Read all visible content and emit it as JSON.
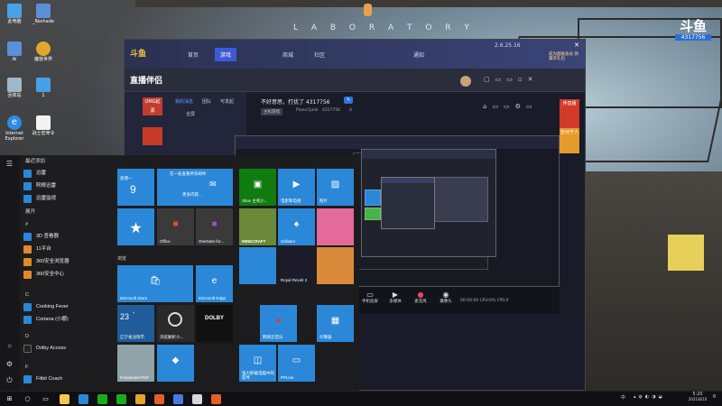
{
  "desktop": {
    "title": "L A B O R A T O R Y",
    "subtitle": "",
    "watermark_mark": "斗鱼",
    "watermark_room": "4317756",
    "icons": [
      {
        "label": "此电脑",
        "color": "#4aa0e6",
        "icon": "computer-icon"
      },
      {
        "label": "_Reshade",
        "color": "#5b8fd8",
        "icon": "folder-icon"
      },
      {
        "label": "Ai",
        "color": "#5b8fd8",
        "icon": "app-icon"
      },
      {
        "label": "魔兽世界",
        "color": "#e0a72a",
        "icon": "game-icon"
      },
      {
        "label": "回收站",
        "color": "#9fb7c9",
        "icon": "recycle-bin-icon"
      },
      {
        "label": "1",
        "color": "#4aa0e6",
        "icon": "app-icon"
      },
      {
        "label": "Internet Explorer",
        "color": "#2b8ae6",
        "icon": "ie-icon"
      },
      {
        "label": "战士宏命令",
        "color": "#f2f2f2",
        "icon": "document-icon"
      }
    ]
  },
  "app_main": {
    "brand": "斗鱼",
    "nav": [
      "首页",
      "游戏",
      "",
      "商城",
      "社区",
      "",
      "",
      "",
      "通知"
    ],
    "active_nav": "游戏",
    "version": "2.6.25.16",
    "promo": "成为超级会员 领豪华礼包",
    "secondary_title": "直播伴侣",
    "left_panel": {
      "label1": "OMG起源",
      "label2": "主页",
      "tabs": [
        "我的消息",
        "团队",
        "可发起"
      ],
      "link": "全屏"
    },
    "stream": {
      "title": "不好意思，打扰了 4317756",
      "owner_tag": "主机游戏",
      "room": "4317756",
      "user": "Piano7pink",
      "likes": "0"
    },
    "side_tabs": [
      "伴直播",
      "告对于人"
    ]
  },
  "live_controls": {
    "buttons": [
      "手机投屏",
      "多媒体",
      "麦克风",
      "摄像头"
    ],
    "status": "00:00:00  CPU:0%  FPS:0"
  },
  "start_menu": {
    "recent_header": "最近添加",
    "recent": [
      {
        "label": "迅雷",
        "color": "#2b88d8"
      },
      {
        "label": "阿根迅雷",
        "color": "#2b88d8"
      },
      {
        "label": "迅雷监视",
        "color": "#2b88d8"
      }
    ],
    "expand": "展开",
    "letter_hash": "#",
    "hash_items": [
      {
        "label": "3D 查看器",
        "color": "#2b88d8"
      },
      {
        "label": "11平台",
        "color": "#e08a2a"
      },
      {
        "label": "360安全浏览器",
        "color": "#e08a2a"
      },
      {
        "label": "360安全中心",
        "color": "#e08a2a"
      }
    ],
    "letter_c": "C",
    "c_items": [
      {
        "label": "Cooking Fever",
        "color": "#2b88d8"
      },
      {
        "label": "Cortana (小娜)",
        "color": "#2b88d8"
      }
    ],
    "letter_d": "D",
    "d_items": [
      {
        "label": "Dolby Access",
        "color": "#222"
      }
    ],
    "letter_f": "F",
    "f_items": [
      {
        "label": "Fitbit Coach",
        "color": "#2b88d8"
      }
    ],
    "group1": "",
    "group2": "浏览",
    "tiles": {
      "calendar_day": "星期一",
      "calendar_num": "9",
      "mail_header": "在一处查看所有邮件",
      "mail_sub": "更多内容...",
      "office": "Office",
      "onenote": "OneNote for...",
      "xbox": "Xbox 主机小...",
      "remote": "电影和电视",
      "photos": "照片",
      "minecraft": "MINECRAFT",
      "solitaire": "Solitaire",
      "royal": "Royal Revolt 2",
      "store": "Microsoft Store",
      "edge": "Microsoft Edge",
      "weather_temp": "23",
      "weather_unit": "°",
      "weather_loc": "辽宁省沈阳市",
      "cortana": "浏览解析小...",
      "dolby": "DOLBY",
      "netease": "网易云音乐",
      "calculator": "计算器",
      "drawboard": "Drawboard PDF",
      "paint3d": "",
      "ppcube": "强力卸载电脑中的软件",
      "pplive": "PPLive"
    }
  },
  "taskbar": {
    "time": "5:20",
    "date": "2021/8/10",
    "ime": "中",
    "tray_badge": "6"
  }
}
